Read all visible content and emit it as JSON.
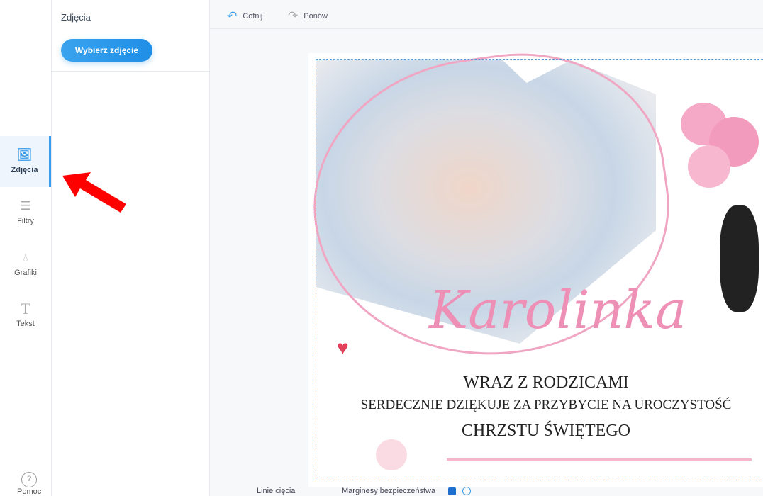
{
  "sidebar": {
    "items": [
      {
        "label": "Zdjęcia",
        "icon": "image-icon"
      },
      {
        "label": "Filtry",
        "icon": "sliders-icon"
      },
      {
        "label": "Grafiki",
        "icon": "drop-icon"
      },
      {
        "label": "Tekst",
        "icon": "text-icon"
      }
    ],
    "help_label": "Pomoc"
  },
  "panel": {
    "title": "Zdjęcia",
    "button": "Wybierz zdjęcie"
  },
  "toolbar": {
    "undo": "Cofnij",
    "redo": "Ponów"
  },
  "design": {
    "name": "Karolinka",
    "line1": "WRAZ Z RODZICAMI",
    "line2": "SERDECZNIE DZIĘKUJE ZA PRZYBYCIE NA UROCZYSTOŚĆ",
    "line3": "CHRZSTU ŚWIĘTEGO"
  },
  "bottom": {
    "cut_lines": "Linie cięcia",
    "safety_margins": "Marginesy bezpieczeństwa"
  },
  "colors": {
    "accent": "#3a9be8",
    "pink": "#ee8fb6",
    "arrow": "#ff0000"
  }
}
